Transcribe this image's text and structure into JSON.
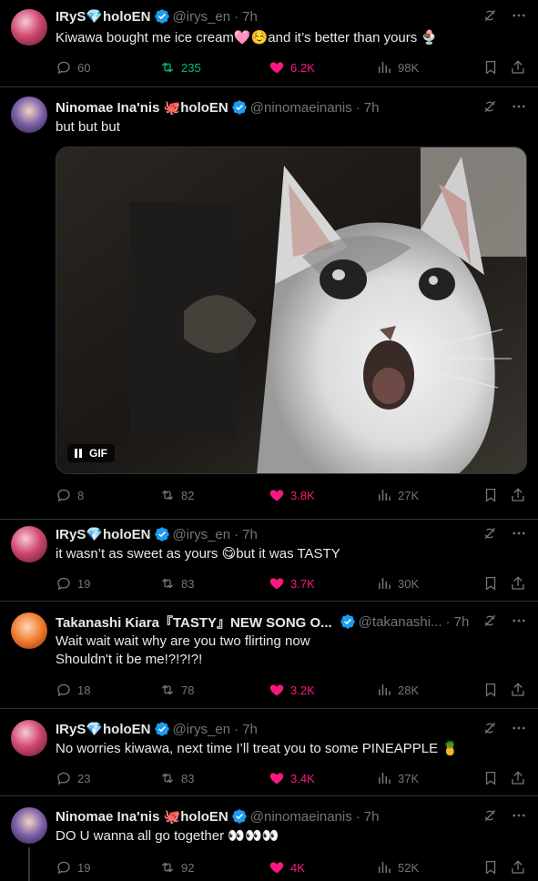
{
  "colors": {
    "accent": "#1d9bf0",
    "retweet_active": "#00ba7c",
    "like_active": "#f91880",
    "muted": "#71767b",
    "bg": "#000000"
  },
  "tweets": [
    {
      "name": "IRyS💎holoEN",
      "handle": "@irys_en",
      "time": "7h",
      "text": "Kiwawa bought me ice cream🩷☺️and it’s better than yours 🍨",
      "replies": "60",
      "retweets": "235",
      "likes": "6.2K",
      "views": "98K",
      "retweet_active": true,
      "like_active": true
    },
    {
      "name": "Ninomae Ina'nis 🐙holoEN",
      "handle": "@ninomaeinanis",
      "time": "7h",
      "text": "but but but",
      "media": {
        "type": "gif",
        "badge": "GIF",
        "description_icon": "surprised-cat-gif"
      },
      "replies": "8",
      "retweets": "82",
      "likes": "3.8K",
      "views": "27K",
      "retweet_active": false,
      "like_active": true
    },
    {
      "name": "IRyS💎holoEN",
      "handle": "@irys_en",
      "time": "7h",
      "text": "it wasn’t as sweet as yours 😋but it was TASTY",
      "replies": "19",
      "retweets": "83",
      "likes": "3.7K",
      "views": "30K",
      "retweet_active": false,
      "like_active": true
    },
    {
      "name": "Takanashi Kiara『TASTY』NEW SONG O...",
      "handle": "@takanashi...",
      "time": "7h",
      "text": "Wait wait wait why are you two flirting now\nShouldn't it be me!?!?!?!",
      "replies": "18",
      "retweets": "78",
      "likes": "3.2K",
      "views": "28K",
      "retweet_active": false,
      "like_active": true
    },
    {
      "name": "IRyS💎holoEN",
      "handle": "@irys_en",
      "time": "7h",
      "text": "No worries kiwawa, next time I’ll treat you to some PINEAPPLE 🍍",
      "replies": "23",
      "retweets": "83",
      "likes": "3.4K",
      "views": "37K",
      "retweet_active": false,
      "like_active": true
    },
    {
      "name": "Ninomae Ina'nis 🐙holoEN",
      "handle": "@ninomaeinanis",
      "time": "7h",
      "text": "DO U wanna all go together 👀👀👀",
      "replies": "19",
      "retweets": "92",
      "likes": "4K",
      "views": "52K",
      "retweet_active": false,
      "like_active": true
    }
  ]
}
